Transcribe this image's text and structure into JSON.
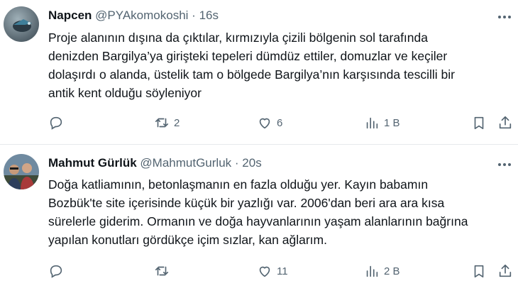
{
  "tweets": [
    {
      "name": "Napcen",
      "handle": "@PYAkomokoshi",
      "separator": "·",
      "time": "16s",
      "text_lines": [
        "Proje alanının dışına da çıktılar, kırmızıyla çizili bölgenin sol tarafında",
        "denizden Bargilya’ya girişteki tepeleri dümdüz ettiler, domuzlar ve keçiler",
        "dolaşırdı o alanda, üstelik tam o bölgede Bargilya’nın karşısında tescilli bir",
        "antik kent olduğu söyleniyor"
      ],
      "replies": "",
      "retweets": "2",
      "likes": "6",
      "views": "1 B",
      "avatar_icon": "bird-avatar"
    },
    {
      "name": "Mahmut Gürlük",
      "handle": "@MahmutGurluk",
      "separator": "·",
      "time": "20s",
      "text_lines": [
        "Doğa katliamının, betonlaşmanın en fazla olduğu yer. Kayın babamın",
        "Bozbük'te site içerisinde küçük bir yazlığı var. 2006'dan beri ara ara kısa",
        "sürelerle giderim. Ormanın ve doğa hayvanlarının yaşam alanlarının bağrına",
        "yapılan konutları gördükçe içim sızlar, kan ağlarım."
      ],
      "replies": "",
      "retweets": "",
      "likes": "11",
      "views": "2 B",
      "avatar_icon": "group-photo-avatar"
    }
  ],
  "icons": {
    "reply": "reply-icon",
    "retweet": "retweet-icon",
    "like": "heart-icon",
    "views": "views-chart-icon",
    "bookmark": "bookmark-icon",
    "share": "share-icon",
    "more": "more-dots-icon"
  },
  "colors": {
    "text": "#0f1419",
    "secondary": "#536471",
    "divider": "#e6e9ec"
  }
}
